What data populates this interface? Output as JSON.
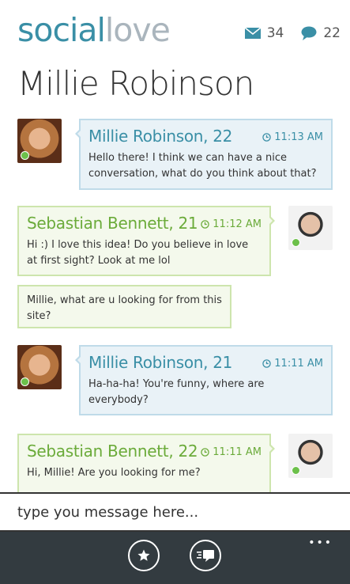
{
  "app": {
    "logo_part1": "social",
    "logo_part2": "love"
  },
  "header": {
    "mail_count": "34",
    "chat_count": "22",
    "conversation_title": "Millie Robinson"
  },
  "messages": [
    {
      "sender": "Millie Robinson",
      "age": ", 22",
      "time": "11:13 AM",
      "text": "Hello there! I think we can have a nice conversation, what do you think about that?"
    },
    {
      "sender": "Sebastian Bennett",
      "age": ", 21",
      "time": "11:12 AM",
      "text": "Hi :) I love this idea! Do you believe in love at first sight? Look at me lol",
      "followup": "Millie, what are u looking for from this site?"
    },
    {
      "sender": "Millie Robinson",
      "age": ", 21",
      "time": "11:11 AM",
      "text": "Ha-ha-ha! You're funny, where are everybody?"
    },
    {
      "sender": "Sebastian Bennett",
      "age": ", 22",
      "time": "11:11 AM",
      "text": "Hi, Millie! Are you looking for me?"
    }
  ],
  "composer": {
    "placeholder": "type you message here..."
  },
  "appbar": {
    "more_label": "•••"
  },
  "colors": {
    "accent_blue": "#3a8fa6",
    "accent_green": "#6bab3a",
    "appbar_bg": "#333b40"
  }
}
